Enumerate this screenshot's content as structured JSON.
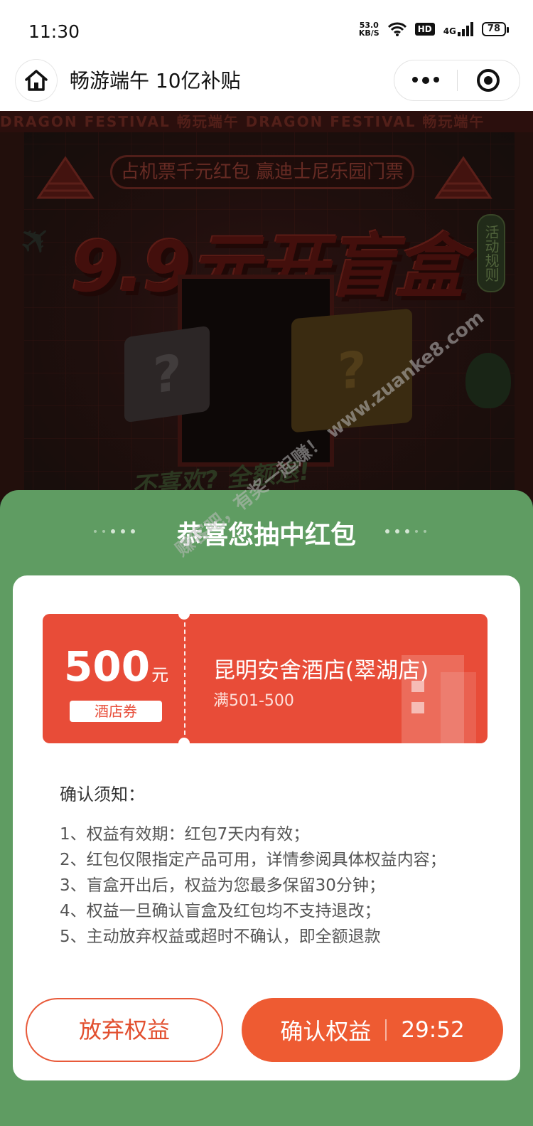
{
  "status_bar": {
    "time": "11:30",
    "speed_value": "53.0",
    "speed_unit": "KB/S",
    "hd": "HD",
    "network": "4G",
    "battery": "78"
  },
  "nav": {
    "title": "畅游端午 10亿补贴",
    "icons": [
      "home-icon",
      "more-icon",
      "target-icon"
    ]
  },
  "banner": {
    "strip_text": "DRAGON FESTIVAL  畅玩端午  DRAGON FESTIVAL  畅玩端午",
    "promo_pill": "占机票千元红包 赢迪士尼乐园门票",
    "headline": "9.9元开盲盒",
    "rules_tab": "活动规则",
    "cube_mark": "?",
    "bottom_text": "不喜欢? 全额退!"
  },
  "modal": {
    "title": "恭喜您抽中红包",
    "coupon": {
      "amount": "500",
      "unit": "元",
      "type": "酒店券",
      "hotel": "昆明安舍酒店(翠湖店)",
      "condition": "满501-500",
      "color": "#e84c38"
    },
    "notice_title": "确认须知：",
    "notice_items": [
      "1、权益有效期：红包7天内有效；",
      "2、红包仅限指定产品可用，详情参阅具体权益内容；",
      "3、盲盒开出后，权益为您最多保留30分钟；",
      "4、权益一旦确认盲盒及红包均不支持退改；",
      "5、主动放弃权益或超时不确认，即全额退款"
    ],
    "abandon_label": "放弃权益",
    "confirm_label": "确认权益",
    "timer": "29:52",
    "sheet_color": "#5f9c62",
    "accent": "#ee5b32"
  },
  "watermark": "赚客吧，有奖一起赚！ www.zuanke8.com"
}
